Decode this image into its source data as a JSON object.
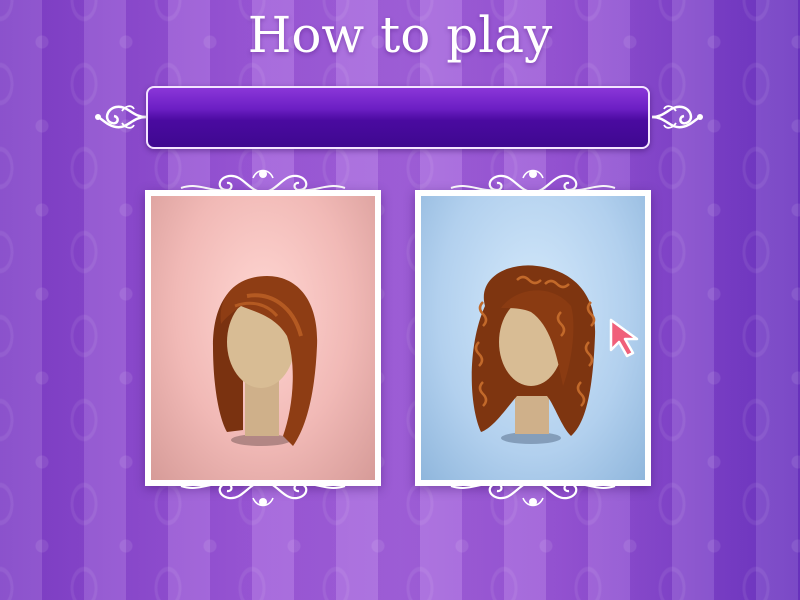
{
  "screen": {
    "title": "How to play"
  },
  "instruction_bar": {
    "text": ""
  },
  "cards": [
    {
      "name": "straight-hair-card",
      "hairstyle": "straight"
    },
    {
      "name": "curly-hair-card",
      "hairstyle": "curly",
      "highlighted": true
    }
  ],
  "colors": {
    "background": "#9a58d6",
    "bar": "#4a0aa0",
    "card_left_bg": "#f1b9b6",
    "card_right_bg": "#b2d0ee",
    "hair": "#8a3b12",
    "skin": "#d2b48c",
    "cursor": "#f0607a"
  },
  "icons": {
    "pointer": "arrow-cursor-icon",
    "ornament": "filigree-scroll-ornament"
  }
}
